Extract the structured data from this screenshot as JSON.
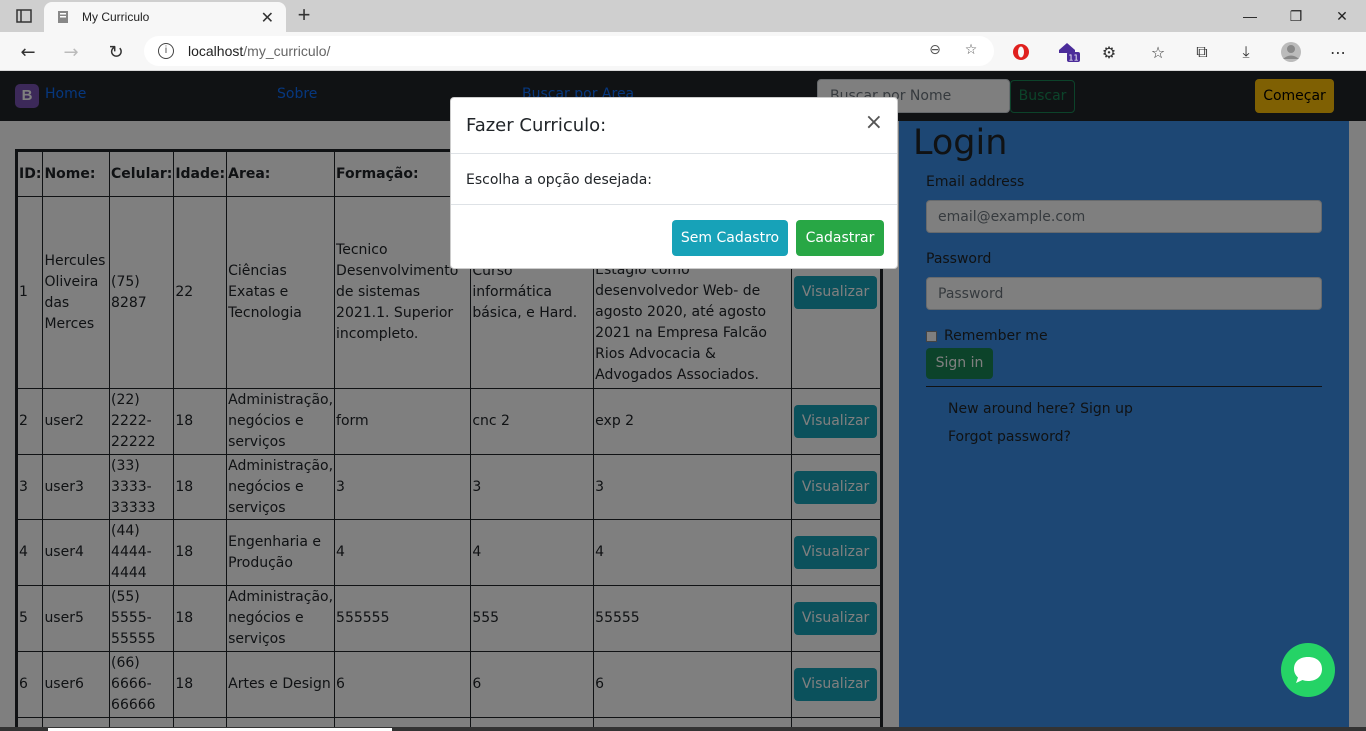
{
  "browser": {
    "tab_title": "My Curriculo",
    "url_host": "localhost",
    "url_path": "/my_curriculo/",
    "extension_badge": "11"
  },
  "navbar": {
    "brand_letter": "B",
    "links": [
      "Home",
      "Sobre",
      "Buscar por Area"
    ],
    "search_placeholder": "Buscar por Nome",
    "search_button": "Buscar",
    "start_button": "Começar"
  },
  "table": {
    "headers": [
      "ID:",
      "Nome:",
      "Celular:",
      "Idade:",
      "Area:",
      "Formação:",
      "",
      "",
      ""
    ],
    "rows": [
      {
        "id": "1",
        "nome": "Hercules Oliveira das Merces",
        "celular": "(75) 8287",
        "idade": "22",
        "area": "Ciências Exatas e Tecnologia",
        "formacao": "Tecnico Desenvolvimento de sistemas 2021.1. Superior incompleto.",
        "cursos": "Curso informática básica, e Hard.",
        "experiencia": "& Advogados Associados. Estagio como desenvolvedor Web- de agosto 2020, até agosto 2021 na Empresa Falcão Rios Advocacia & Advogados Associados.",
        "action": "Visualizar"
      },
      {
        "id": "2",
        "nome": "user2",
        "celular": "(22) 2222-22222",
        "idade": "18",
        "area": "Administração, negócios e serviços",
        "formacao": "form",
        "cursos": "cnc 2",
        "experiencia": "exp 2",
        "action": "Visualizar"
      },
      {
        "id": "3",
        "nome": "user3",
        "celular": "(33) 3333-33333",
        "idade": "18",
        "area": "Administração, negócios e serviços",
        "formacao": "3",
        "cursos": "3",
        "experiencia": "3",
        "action": "Visualizar"
      },
      {
        "id": "4",
        "nome": "user4",
        "celular": "(44) 4444-4444",
        "idade": "18",
        "area": "Engenharia e Produção",
        "formacao": "4",
        "cursos": "4",
        "experiencia": "4",
        "action": "Visualizar"
      },
      {
        "id": "5",
        "nome": "user5",
        "celular": "(55) 5555-55555",
        "idade": "18",
        "area": "Administração, negócios e serviços",
        "formacao": "555555",
        "cursos": "555",
        "experiencia": "55555",
        "action": "Visualizar"
      },
      {
        "id": "6",
        "nome": "user6",
        "celular": "(66) 6666-66666",
        "idade": "18",
        "area": "Artes e Design",
        "formacao": "6",
        "cursos": "6",
        "experiencia": "6",
        "action": "Visualizar"
      }
    ]
  },
  "login": {
    "title": "Login",
    "email_label": "Email address",
    "email_placeholder": "email@example.com",
    "password_label": "Password",
    "password_placeholder": "Password",
    "remember": "Remember me",
    "signin": "Sign in",
    "signup_link": "New around here? Sign up",
    "forgot_link": "Forgot password?"
  },
  "modal": {
    "title": "Fazer Curriculo:",
    "close": "×",
    "body": "Escolha a opção desejada:",
    "btn_no_register": "Sem Cadastro",
    "btn_register": "Cadastrar"
  }
}
